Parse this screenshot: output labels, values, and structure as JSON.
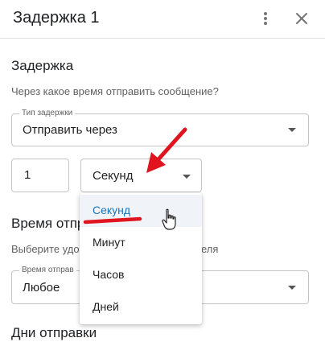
{
  "dialog": {
    "title": "Задержка 1",
    "more_icon": "more-vert-icon",
    "close_icon": "close-icon"
  },
  "delay_section": {
    "title": "Задержка",
    "hint": "Через какое время отправить сообщение?",
    "delay_type": {
      "label": "Тип задержки",
      "value": "Отправить через"
    },
    "amount": {
      "value": "1"
    },
    "unit": {
      "value": "Секунд",
      "options": [
        "Секунд",
        "Минут",
        "Часов",
        "Дней"
      ],
      "selected_index": 0
    }
  },
  "send_time_section": {
    "title": "Время отпр",
    "hint_left": "Выберите удоб",
    "hint_right": "еля",
    "send_time_field": {
      "label": "Время отправ",
      "value": "Любое"
    }
  },
  "send_days_section": {
    "title": "Дни отправки"
  },
  "colors": {
    "accent": "#1a73b8",
    "annotation_red": "#e0141e"
  }
}
